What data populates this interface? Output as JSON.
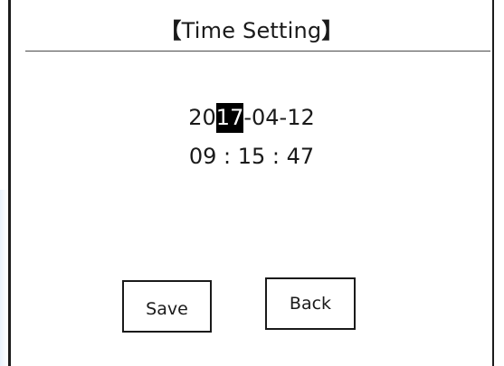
{
  "header": {
    "title_open": "【",
    "title": "Time Setting",
    "title_close": "】"
  },
  "datetime": {
    "date_prefix": "20",
    "date_selected": "17",
    "date_suffix": "-04-12",
    "time": "09 : 15 : 47"
  },
  "buttons": {
    "save_label": "Save",
    "back_label": "Back"
  },
  "colors": {
    "background": "#ffffff",
    "text": "#1a1a1a",
    "selection_bg": "#000000",
    "selection_text": "#ffffff"
  }
}
